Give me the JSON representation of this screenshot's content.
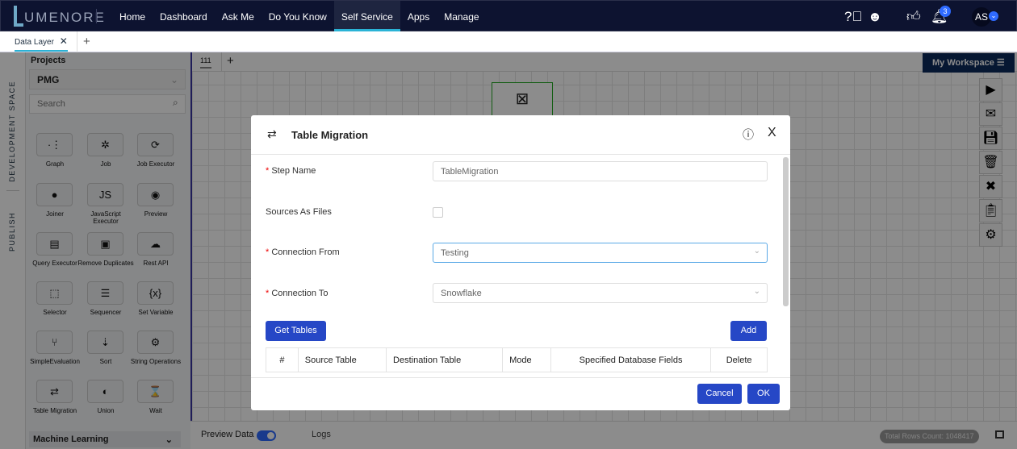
{
  "nav": {
    "logo": "UMENORE",
    "menu": [
      "Home",
      "Dashboard",
      "Ask Me",
      "Do You Know",
      "Self Service",
      "Apps",
      "Manage"
    ],
    "active": "Self Service",
    "notification_count": "3",
    "avatar": "AS",
    "icons": [
      "help-icon",
      "chatbot-icon",
      "thumbs-up-icon",
      "bell-icon"
    ]
  },
  "tabs": {
    "items": [
      "Data Layer"
    ],
    "add": "+"
  },
  "strip": {
    "development": "DEVELOPMENT SPACE",
    "publish": "PUBLISH"
  },
  "sidebar": {
    "projects_label": "Projects",
    "project": "PMG",
    "search_placeholder": "Search",
    "items": [
      {
        "label": "Graph",
        "icon": "·⋮"
      },
      {
        "label": "Job",
        "icon": "✲"
      },
      {
        "label": "Job Executor",
        "icon": "⟳"
      },
      {
        "label": "Joiner",
        "icon": "●"
      },
      {
        "label": "JavaScript Executor",
        "icon": "JS"
      },
      {
        "label": "Preview",
        "icon": "◉"
      },
      {
        "label": "Query Executor",
        "icon": "▤"
      },
      {
        "label": "Remove Duplicates",
        "icon": "▣"
      },
      {
        "label": "Rest API",
        "icon": "☁"
      },
      {
        "label": "Selector",
        "icon": "⬚"
      },
      {
        "label": "Sequencer",
        "icon": "☰"
      },
      {
        "label": "Set Variable",
        "icon": "{x}"
      },
      {
        "label": "SimpleEvaluation",
        "icon": "⑂"
      },
      {
        "label": "Sort",
        "icon": "⇣"
      },
      {
        "label": "String Operations",
        "icon": "⚙"
      },
      {
        "label": "Table Migration",
        "icon": "⇄"
      },
      {
        "label": "Union",
        "icon": "◐"
      },
      {
        "label": "Wait",
        "icon": "⌛"
      }
    ],
    "section": "Machine Learning"
  },
  "canvas": {
    "tab": "111",
    "add": "+",
    "workspace": "My Workspace",
    "tools": [
      "play-icon",
      "mail-icon",
      "save-icon",
      "trash-icon",
      "tools-icon",
      "schedule-icon",
      "settings-icon"
    ]
  },
  "bottom": {
    "preview": "Preview Data",
    "logs": "Logs",
    "rows": "Total Rows Count: 1048417"
  },
  "dialog": {
    "title": "Table Migration",
    "step_name_label": "Step Name",
    "step_name_value": "TableMigration",
    "sources_label": "Sources As Files",
    "sources_checked": false,
    "conn_from_label": "Connection From",
    "conn_from_value": "Testing",
    "conn_to_label": "Connection To",
    "conn_to_value": "Snowflake",
    "get_tables": "Get Tables",
    "add": "Add",
    "columns": [
      "#",
      "Source Table",
      "Destination Table",
      "Mode",
      "Specified Database Fields",
      "Delete"
    ],
    "cancel": "Cancel",
    "ok": "OK"
  }
}
